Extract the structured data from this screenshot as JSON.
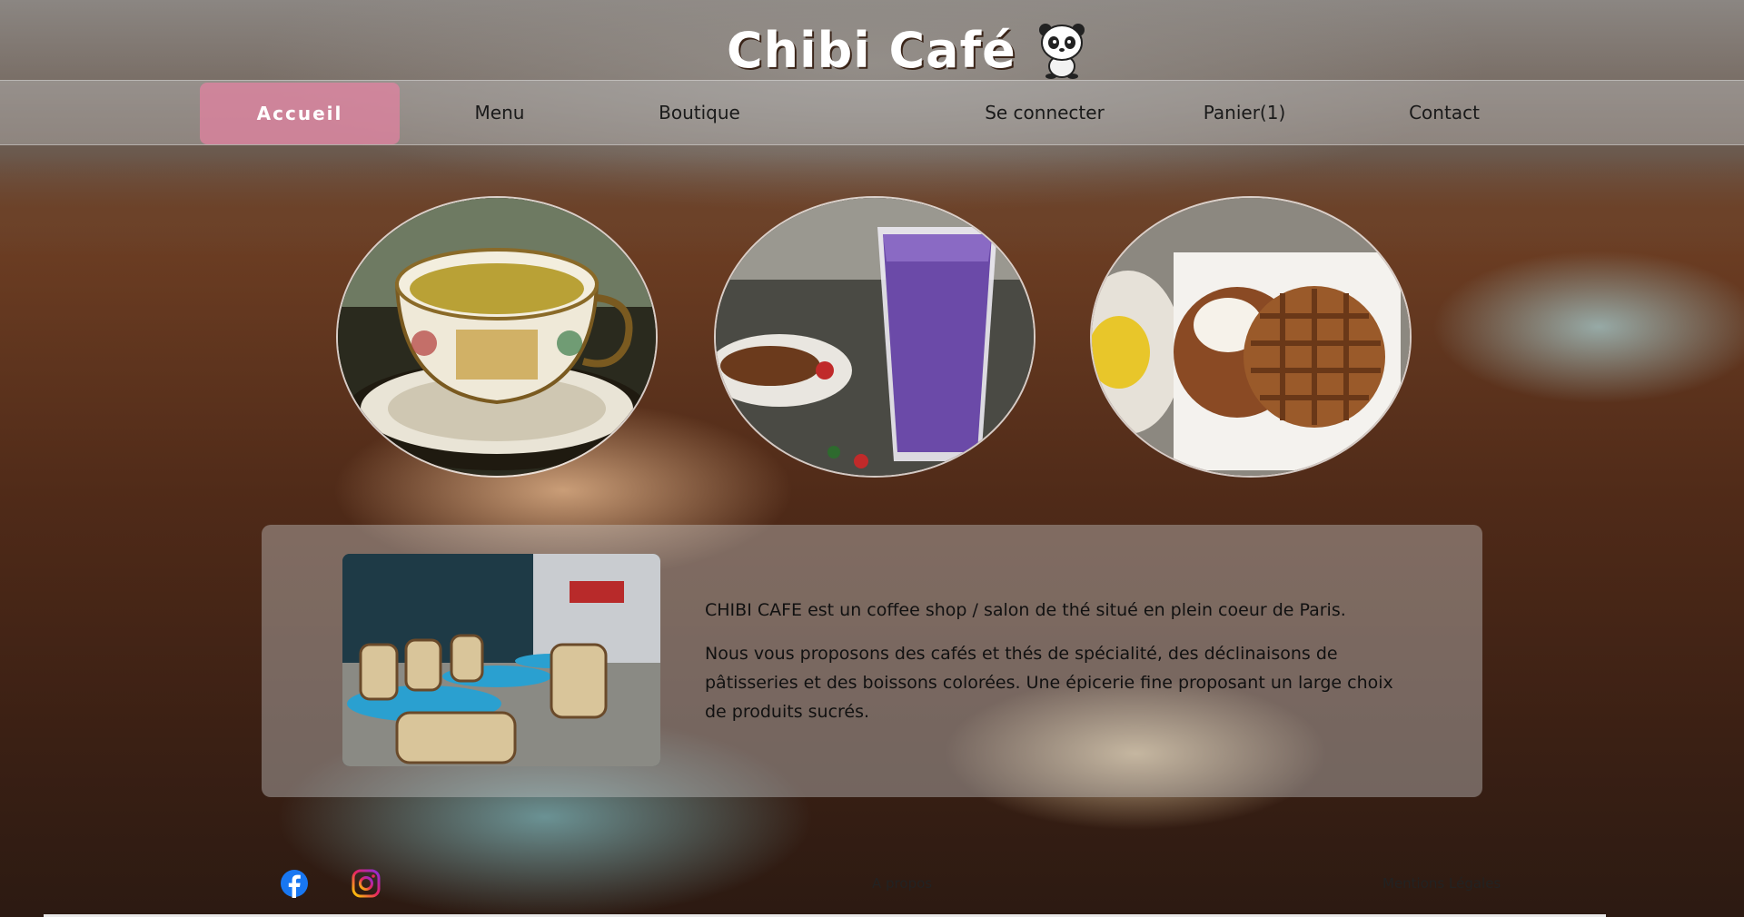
{
  "brand": {
    "title": "Chibi Café"
  },
  "nav": {
    "items": [
      {
        "label": "Accueil",
        "active": true
      },
      {
        "label": "Menu"
      },
      {
        "label": "Boutique"
      },
      {
        "label": "Se connecter"
      },
      {
        "label": "Panier(1)"
      },
      {
        "label": "Contact"
      }
    ]
  },
  "gallery": {
    "images": [
      "tea-cup-image",
      "purple-smoothie-image",
      "waffle-pastry-image"
    ]
  },
  "intro": {
    "image": "paris-cafe-terrace-image",
    "paragraph1": "CHIBI CAFE est un coffee shop / salon de thé situé en plein coeur de Paris.",
    "paragraph2": "Nous vous proposons des cafés et thés de spécialité, des déclinaisons de pâtisseries et des boissons colorées. Une épicerie fine proposant un large choix de produits sucrés."
  },
  "footer": {
    "about": "A propos",
    "legal": "Mentions Légales",
    "social": [
      "facebook-icon",
      "instagram-icon"
    ]
  },
  "colors": {
    "active_nav": "#e182a0",
    "facebook": "#1877f2",
    "instagram": "#d6249f"
  }
}
